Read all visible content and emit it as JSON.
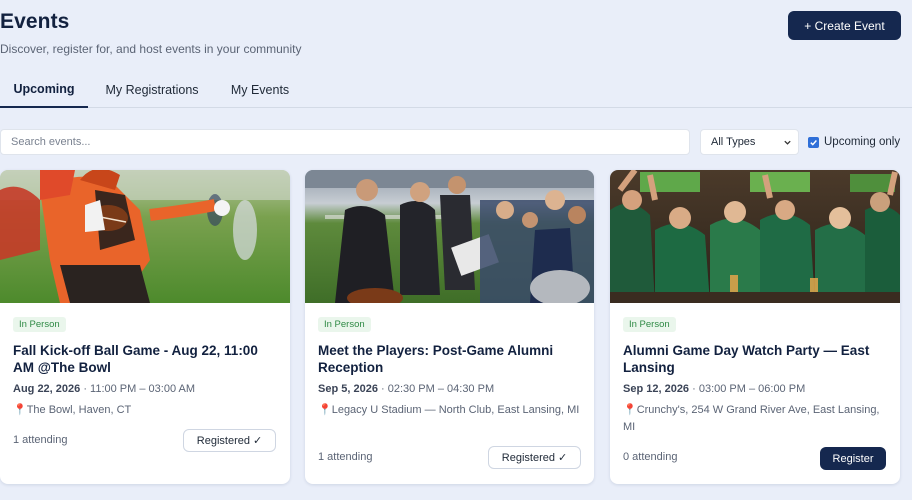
{
  "header": {
    "title": "Events",
    "subtitle": "Discover, register for, and host events in your community",
    "create_label": "+ Create Event"
  },
  "tabs": [
    {
      "label": "Upcoming",
      "active": true
    },
    {
      "label": "My Registrations",
      "active": false
    },
    {
      "label": "My Events",
      "active": false
    }
  ],
  "filters": {
    "search_placeholder": "Search events...",
    "search_value": "",
    "type_selected": "All Types",
    "upcoming_only_label": "Upcoming only",
    "upcoming_only_checked": true
  },
  "events": [
    {
      "badge": "In Person",
      "title": "Fall Kick-off Ball Game - Aug 22, 11:00 AM @The Bowl",
      "date": "Aug 22, 2026",
      "time": " · 11:00 PM – 03:00 AM",
      "location": "The Bowl, Haven, CT",
      "attending": "1 attending",
      "action_label": "Registered ✓",
      "registered": true
    },
    {
      "badge": "In Person",
      "title": "Meet the Players: Post-Game Alumni Reception",
      "date": "Sep 5, 2026",
      "time": " · 02:30 PM – 04:30 PM",
      "location": "Legacy U Stadium — North Club, East Lansing, MI",
      "attending": "1 attending",
      "action_label": "Registered ✓",
      "registered": true
    },
    {
      "badge": "In Person",
      "title": "Alumni Game Day Watch Party — East Lansing",
      "date": "Sep 12, 2026",
      "time": " · 03:00 PM – 06:00 PM",
      "location": "Crunchy's, 254 W Grand River Ave, East Lansing, MI",
      "attending": "0 attending",
      "action_label": "Register",
      "registered": false
    }
  ],
  "colors": {
    "background": "#e9eef9",
    "primary": "#15284f",
    "badge_green": "#2f8a45",
    "checkbox_blue": "#2f6fd8"
  }
}
